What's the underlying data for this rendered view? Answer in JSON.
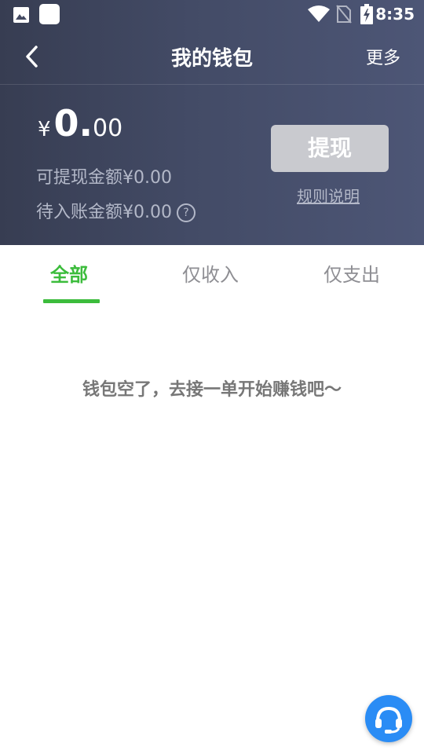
{
  "status_bar": {
    "time": "8:35"
  },
  "nav": {
    "title": "我的钱包",
    "more_label": "更多"
  },
  "balance": {
    "currency_symbol": "¥",
    "integer": "0.",
    "decimal": "00",
    "withdrawable_label": "可提现金额",
    "withdrawable_value": "¥0.00",
    "pending_label": "待入账金额",
    "pending_value": "¥0.00",
    "help_symbol": "?"
  },
  "actions": {
    "withdraw_label": "提现",
    "rules_label": "规则说明"
  },
  "tabs": [
    {
      "label": "全部",
      "active": true
    },
    {
      "label": "仅收入",
      "active": false
    },
    {
      "label": "仅支出",
      "active": false
    }
  ],
  "empty_state": {
    "message": "钱包空了，去接一单开始赚钱吧～"
  },
  "colors": {
    "header_start": "#373d52",
    "header_end": "#4d5676",
    "accent": "#3cbc3c",
    "cs_button": "#2a8cf5"
  },
  "icons": [
    "gallery-icon",
    "app-icon",
    "wifi-icon",
    "no-sim-icon",
    "battery-charging-icon",
    "back-arrow-icon",
    "help-icon",
    "headset-icon"
  ]
}
